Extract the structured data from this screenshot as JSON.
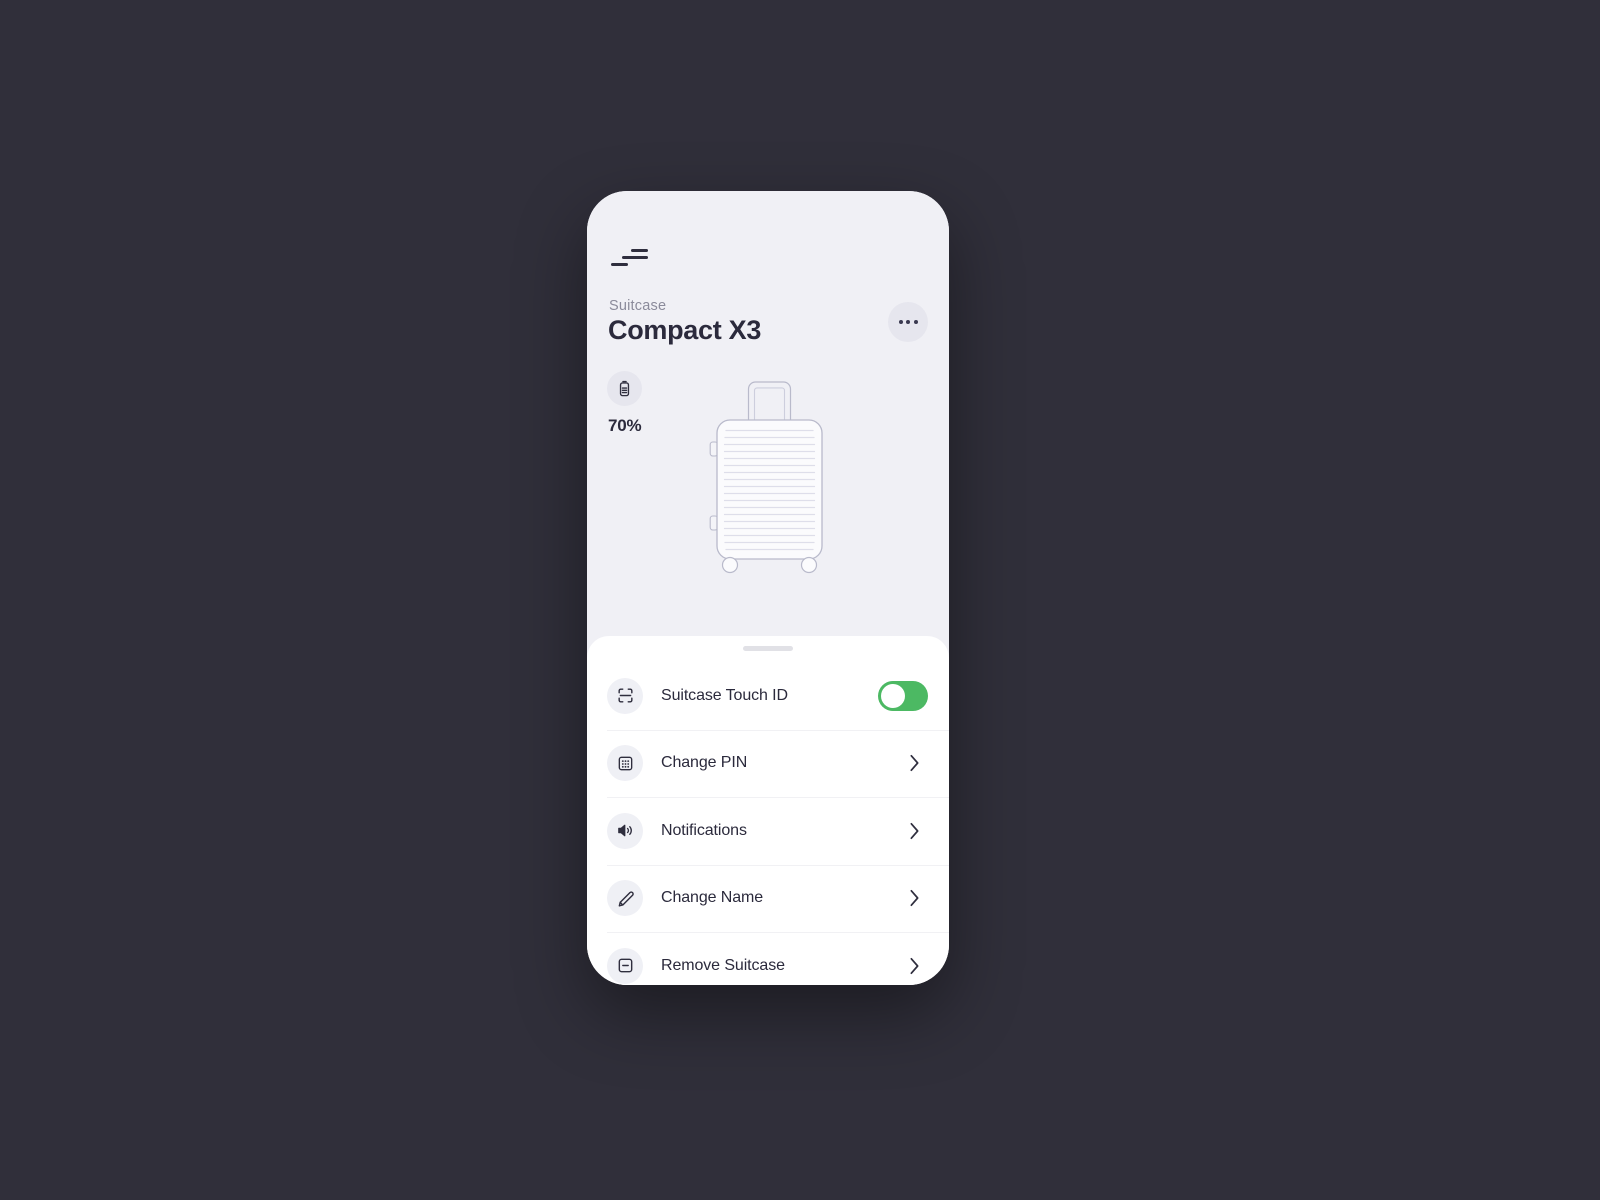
{
  "theme": {
    "page_background": "#302f3a",
    "screen_background": "#f0f0f5",
    "sheet_background": "#ffffff",
    "accent_green": "#4cb963",
    "text_primary": "#2b2a3c",
    "text_muted": "#8b8b9b",
    "icon_chip_background": "#eff0f5"
  },
  "header": {
    "menu_icon": "hamburger-menu-icon",
    "eyebrow": "Suitcase",
    "title": "Compact X3",
    "more_icon": "more-horizontal-icon"
  },
  "status": {
    "battery_icon": "battery-icon",
    "battery_level": "70%"
  },
  "illustration": {
    "name": "suitcase-illustration",
    "rib_count": 20
  },
  "sheet": {
    "drag_handle": "drag-handle",
    "items": [
      {
        "id": "suitcase-touch-id",
        "label": "Suitcase Touch ID",
        "icon": "scan-face-icon",
        "control": "toggle",
        "toggle_on": true,
        "knob_position": "left"
      },
      {
        "id": "change-pin",
        "label": "Change PIN",
        "icon": "keypad-icon",
        "control": "chevron",
        "chevron_icon": "chevron-right-icon"
      },
      {
        "id": "notifications",
        "label": "Notifications",
        "icon": "speaker-volume-icon",
        "control": "chevron",
        "chevron_icon": "chevron-right-icon"
      },
      {
        "id": "change-name",
        "label": "Change Name",
        "icon": "pencil-edit-icon",
        "control": "chevron",
        "chevron_icon": "chevron-right-icon"
      },
      {
        "id": "remove-suitcase",
        "label": "Remove Suitcase",
        "icon": "minus-square-icon",
        "control": "chevron",
        "chevron_icon": "chevron-right-icon"
      }
    ]
  }
}
